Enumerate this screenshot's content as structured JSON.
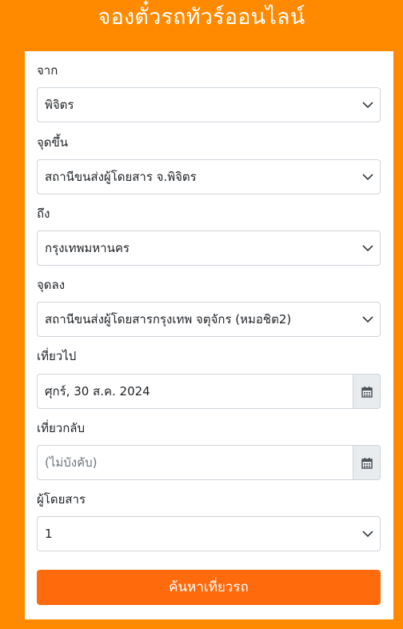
{
  "header": {
    "title": "จองตั๋วรถทัวร์ออนไลน์"
  },
  "form": {
    "from": {
      "label": "จาก",
      "value": "พิจิตร"
    },
    "boarding_point": {
      "label": "จุดขึ้น",
      "value": "สถานีขนส่งผู้โดยสาร จ.พิจิตร"
    },
    "to": {
      "label": "ถึง",
      "value": "กรุงเทพมหานคร"
    },
    "drop_point": {
      "label": "จุดลง",
      "value": "สถานีขนส่งผู้โดยสารกรุงเทพ จตุจักร (หมอชิต2)"
    },
    "departure": {
      "label": "เที่ยวไป",
      "value": "ศุกร์, 30 ส.ค. 2024",
      "icon": "calendar-icon"
    },
    "return": {
      "label": "เที่ยวกลับ",
      "placeholder": "(ไม่บังคับ)",
      "icon": "calendar-icon"
    },
    "passengers": {
      "label": "ผู้โดยสาร",
      "value": "1"
    },
    "submit_label": "ค้นหาเที่ยวรถ"
  },
  "colors": {
    "background": "#ff8a00",
    "button": "#ff6a0d",
    "card": "#ffffff"
  }
}
